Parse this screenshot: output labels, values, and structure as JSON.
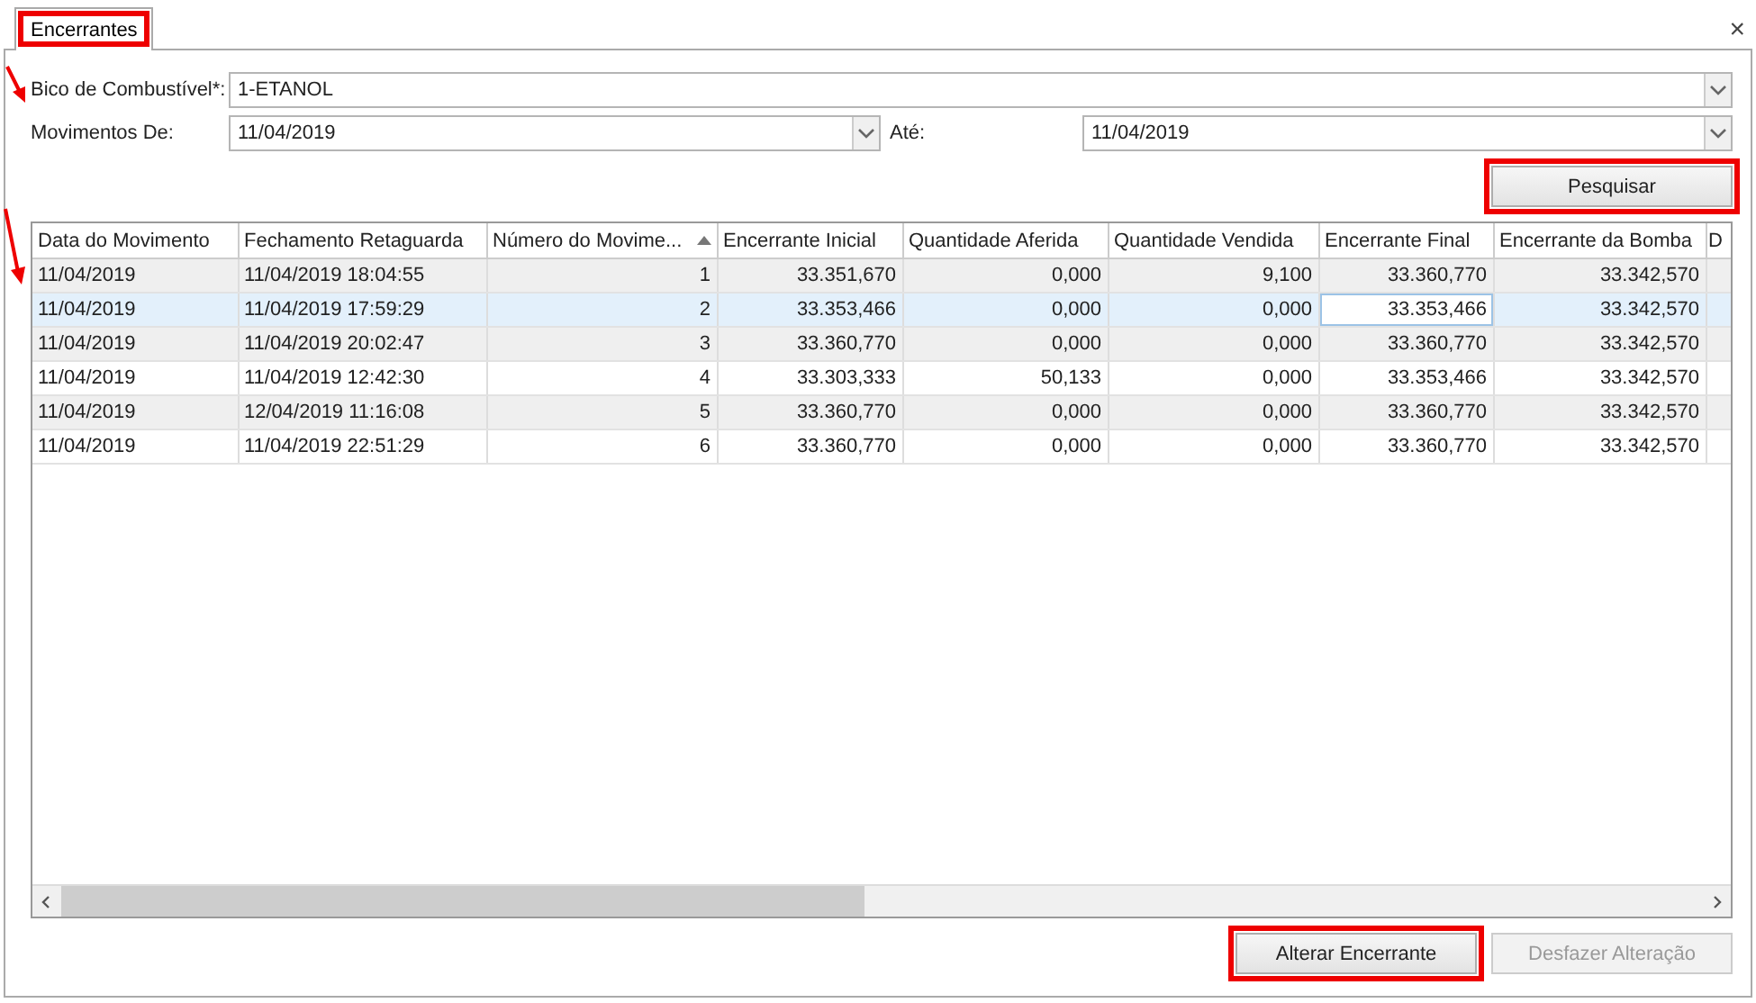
{
  "tabs": [
    {
      "label": "Encerrantes",
      "selected": true,
      "highlighted": true
    }
  ],
  "close_label": "×",
  "filters": {
    "bico": {
      "label": "Bico de Combustível*:",
      "value": "1-ETANOL"
    },
    "movimentos_de": {
      "label": "Movimentos De:",
      "value": "11/04/2019"
    },
    "ate": {
      "label": "Até:",
      "value": "11/04/2019"
    },
    "search_button": {
      "label": "Pesquisar",
      "highlighted": true
    }
  },
  "table": {
    "columns": [
      {
        "label": "Data do Movimento",
        "sorted_ascending": false
      },
      {
        "label": "Fechamento Retaguarda",
        "sorted_ascending": false
      },
      {
        "label": "Número do Movime...",
        "sorted_ascending": true
      },
      {
        "label": "Encerrante Inicial",
        "sorted_ascending": false
      },
      {
        "label": "Quantidade Aferida",
        "sorted_ascending": false
      },
      {
        "label": "Quantidade Vendida",
        "sorted_ascending": false
      },
      {
        "label": "Encerrante Final",
        "sorted_ascending": false
      },
      {
        "label": "Encerrante da Bomba",
        "sorted_ascending": false
      },
      {
        "label": "D",
        "sorted_ascending": false
      }
    ],
    "rows": [
      {
        "selected": false,
        "cells": [
          {
            "text": "11/04/2019",
            "focused": false
          },
          {
            "text": "11/04/2019 18:04:55",
            "focused": false
          },
          {
            "text": "1",
            "focused": false
          },
          {
            "text": "33.351,670",
            "focused": false
          },
          {
            "text": "0,000",
            "focused": false
          },
          {
            "text": "9,100",
            "focused": false
          },
          {
            "text": "33.360,770",
            "focused": false
          },
          {
            "text": "33.342,570",
            "focused": false
          }
        ]
      },
      {
        "selected": true,
        "cells": [
          {
            "text": "11/04/2019",
            "focused": false
          },
          {
            "text": "11/04/2019 17:59:29",
            "focused": false
          },
          {
            "text": "2",
            "focused": false
          },
          {
            "text": "33.353,466",
            "focused": false
          },
          {
            "text": "0,000",
            "focused": false
          },
          {
            "text": "0,000",
            "focused": false
          },
          {
            "text": "33.353,466",
            "focused": true
          },
          {
            "text": "33.342,570",
            "focused": false
          }
        ]
      },
      {
        "selected": false,
        "cells": [
          {
            "text": "11/04/2019",
            "focused": false
          },
          {
            "text": "11/04/2019 20:02:47",
            "focused": false
          },
          {
            "text": "3",
            "focused": false
          },
          {
            "text": "33.360,770",
            "focused": false
          },
          {
            "text": "0,000",
            "focused": false
          },
          {
            "text": "0,000",
            "focused": false
          },
          {
            "text": "33.360,770",
            "focused": false
          },
          {
            "text": "33.342,570",
            "focused": false
          }
        ]
      },
      {
        "selected": false,
        "cells": [
          {
            "text": "11/04/2019",
            "focused": false
          },
          {
            "text": "11/04/2019 12:42:30",
            "focused": false
          },
          {
            "text": "4",
            "focused": false
          },
          {
            "text": "33.303,333",
            "focused": false
          },
          {
            "text": "50,133",
            "focused": false
          },
          {
            "text": "0,000",
            "focused": false
          },
          {
            "text": "33.353,466",
            "focused": false
          },
          {
            "text": "33.342,570",
            "focused": false
          }
        ]
      },
      {
        "selected": false,
        "cells": [
          {
            "text": "11/04/2019",
            "focused": false
          },
          {
            "text": "12/04/2019 11:16:08",
            "focused": false
          },
          {
            "text": "5",
            "focused": false
          },
          {
            "text": "33.360,770",
            "focused": false
          },
          {
            "text": "0,000",
            "focused": false
          },
          {
            "text": "0,000",
            "focused": false
          },
          {
            "text": "33.360,770",
            "focused": false
          },
          {
            "text": "33.342,570",
            "focused": false
          }
        ]
      },
      {
        "selected": false,
        "cells": [
          {
            "text": "11/04/2019",
            "focused": false
          },
          {
            "text": "11/04/2019 22:51:29",
            "focused": false
          },
          {
            "text": "6",
            "focused": false
          },
          {
            "text": "33.360,770",
            "focused": false
          },
          {
            "text": "0,000",
            "focused": false
          },
          {
            "text": "0,000",
            "focused": false
          },
          {
            "text": "33.360,770",
            "focused": false
          },
          {
            "text": "33.342,570",
            "focused": false
          }
        ]
      }
    ]
  },
  "buttons": [
    {
      "label": "Alterar Encerrante",
      "disabled": false,
      "highlighted": true
    },
    {
      "label": "Desfazer Alteração",
      "disabled": true,
      "highlighted": false
    }
  ]
}
